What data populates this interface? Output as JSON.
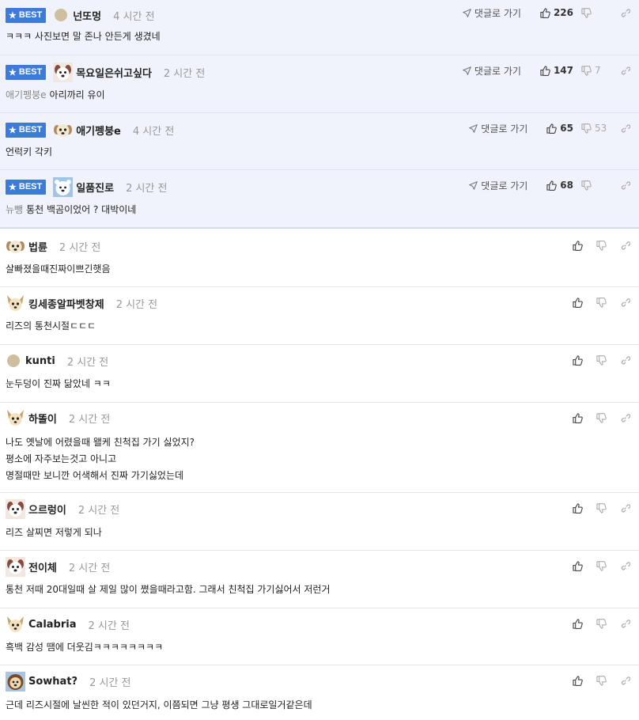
{
  "labels": {
    "best": "BEST",
    "reply": "댓글로 가기"
  },
  "best_comments": [
    {
      "nick": "넌또멍",
      "time": "4 시간 전",
      "mention": "",
      "text": "ㅋㅋㅋ 사진보면 말 존나 안든게 생겼네",
      "up": "226",
      "down": "",
      "avatar": "circle"
    },
    {
      "nick": "목요일은쉬고싶다",
      "time": "2 시간 전",
      "mention": "애기펭붕e",
      "text": "아리까리 유이",
      "up": "147",
      "down": "7",
      "avatar": "dog-face"
    },
    {
      "nick": "애기펭붕e",
      "time": "4 시간 전",
      "mention": "",
      "text": "언럭키 각키",
      "up": "65",
      "down": "53",
      "avatar": "puppy"
    },
    {
      "nick": "일품진로",
      "time": "2 시간 전",
      "mention": "뉴뺑",
      "text": "통천 백곰이었어 ? 대박이네",
      "up": "68",
      "down": "",
      "avatar": "polar-bear"
    }
  ],
  "comments": [
    {
      "nick": "법륜",
      "time": "2 시간 전",
      "lines": [
        "살빠졌을때진짜이쁘긴햇음"
      ],
      "avatar": "puppy"
    },
    {
      "nick": "킹세종알파벳창제",
      "time": "2 시간 전",
      "lines": [
        "리즈의 통천시절ㄷㄷㄷ"
      ],
      "avatar": "chihuahua"
    },
    {
      "nick": "kunti",
      "time": "2 시간 전",
      "lines": [
        "눈두덩이 진짜 닮았네 ㅋㅋ"
      ],
      "avatar": "circle"
    },
    {
      "nick": "하똘이",
      "time": "2 시간 전",
      "lines": [
        "나도 옛날에 어렸을때 왤케 친척집 가기 싫었지?",
        "평소에 자주보는것고 아니고",
        "명절때만 보니깐 어색해서 진짜 가기싫었는데"
      ],
      "avatar": "chihuahua"
    },
    {
      "nick": "으르렁이",
      "time": "2 시간 전",
      "lines": [
        "리즈 살찌면 저렇게 되나"
      ],
      "avatar": "dog-face"
    },
    {
      "nick": "전이체",
      "time": "2 시간 전",
      "lines": [
        "통천 저때 20대일때 살 제일 많이 쪘을때라고함. 그래서 친척집 가기싫어서 저런거"
      ],
      "avatar": "dog-face"
    },
    {
      "nick": "Calabria",
      "time": "2 시간 전",
      "lines": [
        "흑백 감성 땜에 더웃김ㅋㅋㅋㅋㅋㅋㅋㅋ"
      ],
      "avatar": "chihuahua"
    },
    {
      "nick": "Sowhat?",
      "time": "2 시간 전",
      "lines": [
        "근데 리즈시절에 날씬한 적이 있던거지, 이쯤되면 그냥 평생 그대로일거같은데"
      ],
      "avatar": "lion-dog"
    }
  ]
}
